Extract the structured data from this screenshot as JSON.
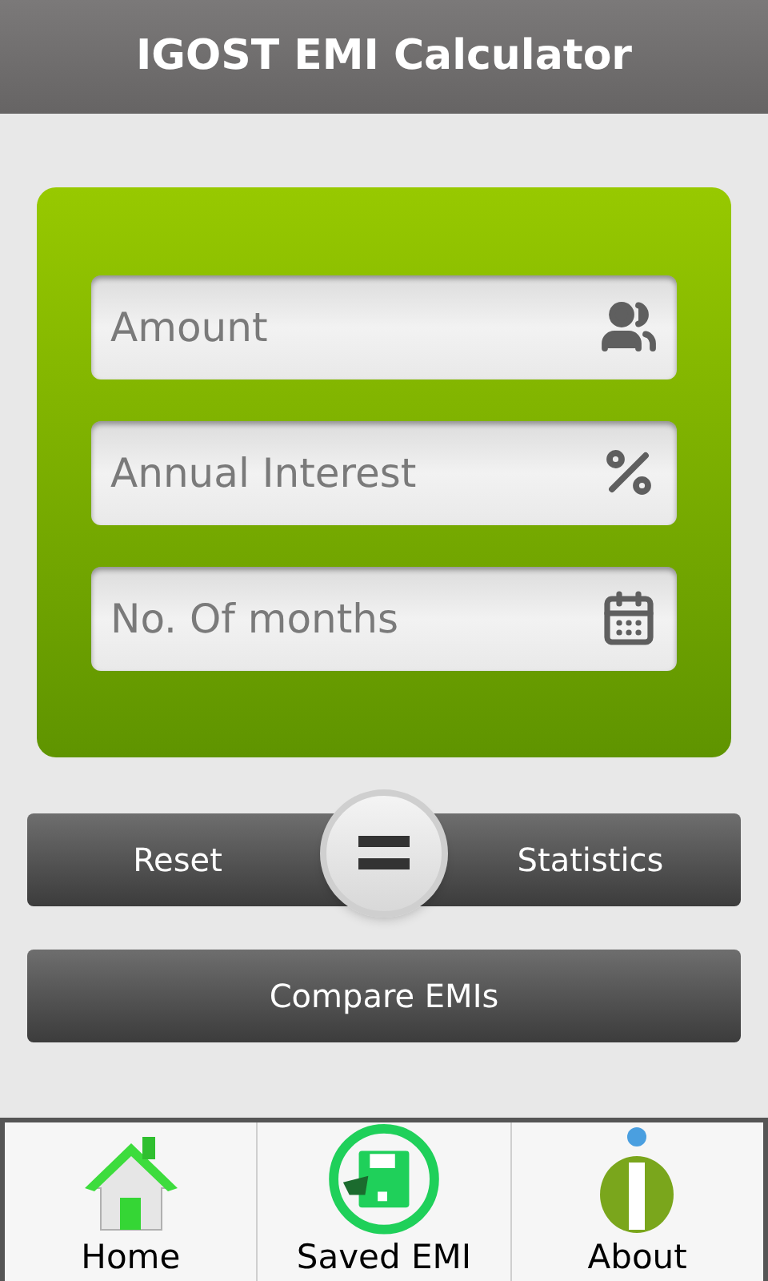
{
  "header": {
    "title": "IGOST EMI Calculator"
  },
  "fields": [
    {
      "placeholder": "Amount",
      "kind": "people"
    },
    {
      "placeholder": "Annual Interest",
      "kind": "percent"
    },
    {
      "placeholder": "No. Of months",
      "kind": "calendar"
    }
  ],
  "actions": {
    "left": "Reset",
    "right": "Statistics",
    "wide": "Compare EMIs"
  },
  "tabs": [
    {
      "label": "Home",
      "kind": "home"
    },
    {
      "label": "Saved EMI",
      "kind": "save"
    },
    {
      "label": "About",
      "kind": "info"
    }
  ]
}
